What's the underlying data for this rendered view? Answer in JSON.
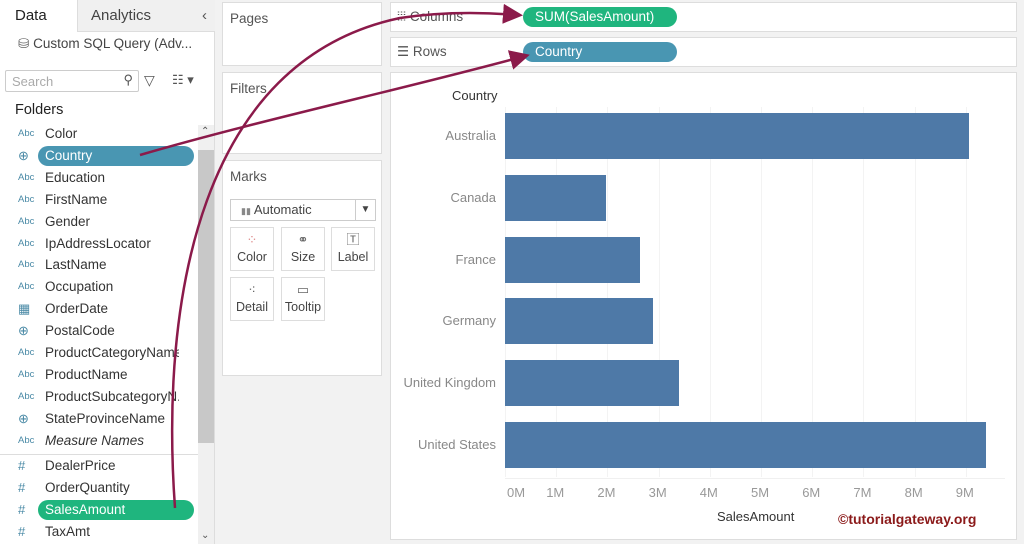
{
  "left_panel": {
    "tabs": {
      "data": "Data",
      "analytics": "Analytics"
    },
    "collapse": "‹",
    "datasource": "Custom SQL Query (Adv...",
    "search_placeholder": "Search",
    "folders_label": "Folders",
    "dimensions": [
      {
        "type": "Abc",
        "name": "Color"
      },
      {
        "type": "globe",
        "name": "Country",
        "selected": true
      },
      {
        "type": "Abc",
        "name": "Education"
      },
      {
        "type": "Abc",
        "name": "FirstName"
      },
      {
        "type": "Abc",
        "name": "Gender"
      },
      {
        "type": "Abc",
        "name": "IpAddressLocator"
      },
      {
        "type": "Abc",
        "name": "LastName"
      },
      {
        "type": "Abc",
        "name": "Occupation"
      },
      {
        "type": "date",
        "name": "OrderDate"
      },
      {
        "type": "globe",
        "name": "PostalCode"
      },
      {
        "type": "Abc",
        "name": "ProductCategoryName"
      },
      {
        "type": "Abc",
        "name": "ProductName"
      },
      {
        "type": "Abc",
        "name": "ProductSubcategoryN..."
      },
      {
        "type": "globe",
        "name": "StateProvinceName"
      },
      {
        "type": "Abc",
        "name": "Measure Names",
        "italic": true
      }
    ],
    "measures": [
      {
        "type": "#",
        "name": "DealerPrice"
      },
      {
        "type": "#",
        "name": "OrderQuantity"
      },
      {
        "type": "#",
        "name": "SalesAmount",
        "selected": true
      },
      {
        "type": "#",
        "name": "TaxAmt"
      }
    ]
  },
  "cards": {
    "pages": "Pages",
    "filters": "Filters",
    "marks": "Marks",
    "mark_type": "Automatic",
    "buttons": [
      "Color",
      "Size",
      "Label",
      "Detail",
      "Tooltip"
    ]
  },
  "shelves": {
    "columns_label": "Columns",
    "columns_pill": "SUM(SalesAmount)",
    "rows_label": "Rows",
    "rows_pill": "Country"
  },
  "colors": {
    "dimension_pill": "#4996b2",
    "measure_pill": "#1fb57e",
    "bar": "#4e79a7",
    "arrow": "#8b1a4a"
  },
  "chart_data": {
    "type": "bar",
    "orientation": "horizontal",
    "row_header": "Country",
    "xlabel": "SalesAmount",
    "categories": [
      "Australia",
      "Canada",
      "France",
      "Germany",
      "United Kingdom",
      "United States"
    ],
    "values": [
      9061000,
      1977845,
      2644018,
      2894312,
      3391712,
      9389790
    ],
    "xticks": [
      "0M",
      "1M",
      "2M",
      "3M",
      "4M",
      "5M",
      "6M",
      "7M",
      "8M",
      "9M"
    ],
    "xlim": [
      0,
      9500000
    ]
  },
  "watermark": "©tutorialgateway.org"
}
